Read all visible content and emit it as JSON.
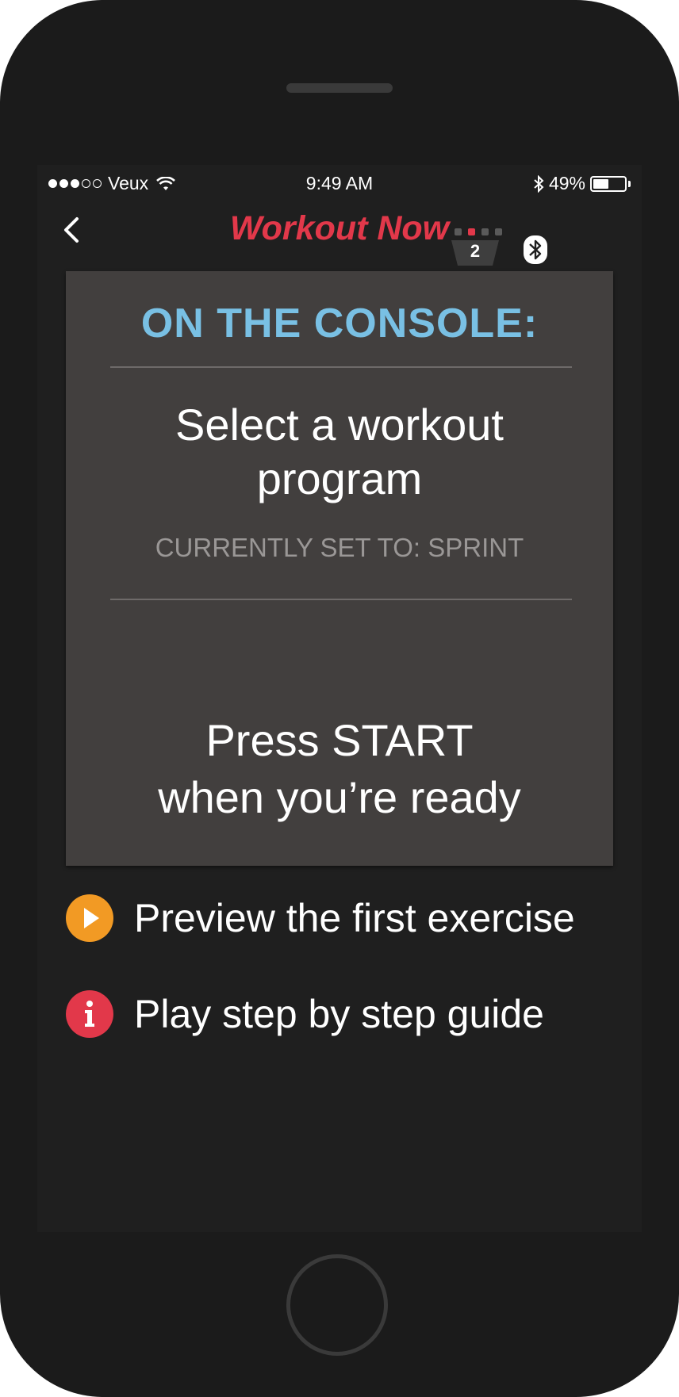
{
  "status_bar": {
    "carrier": "Veux",
    "time": "9:49 AM",
    "battery_percent": "49%",
    "battery_level": 0.49,
    "signal_bars": 3
  },
  "nav": {
    "title": "Workout Now",
    "level_number": "2",
    "level_active_index": 1,
    "title_color": "#e2384a"
  },
  "console": {
    "heading": "ON THE CONSOLE:",
    "step_select_line1": "Select a workout",
    "step_select_line2": "program",
    "current_setting": "CURRENTLY SET TO: SPRINT",
    "step_start_line1": "Press START",
    "step_start_line2": "when you’re ready",
    "heading_color": "#79c0e4"
  },
  "actions": {
    "preview_label": "Preview the first exercise",
    "preview_icon": "play-icon",
    "preview_color": "#f29a24",
    "guide_label": "Play step by step guide",
    "guide_icon": "info-icon",
    "guide_color": "#e2384a"
  }
}
